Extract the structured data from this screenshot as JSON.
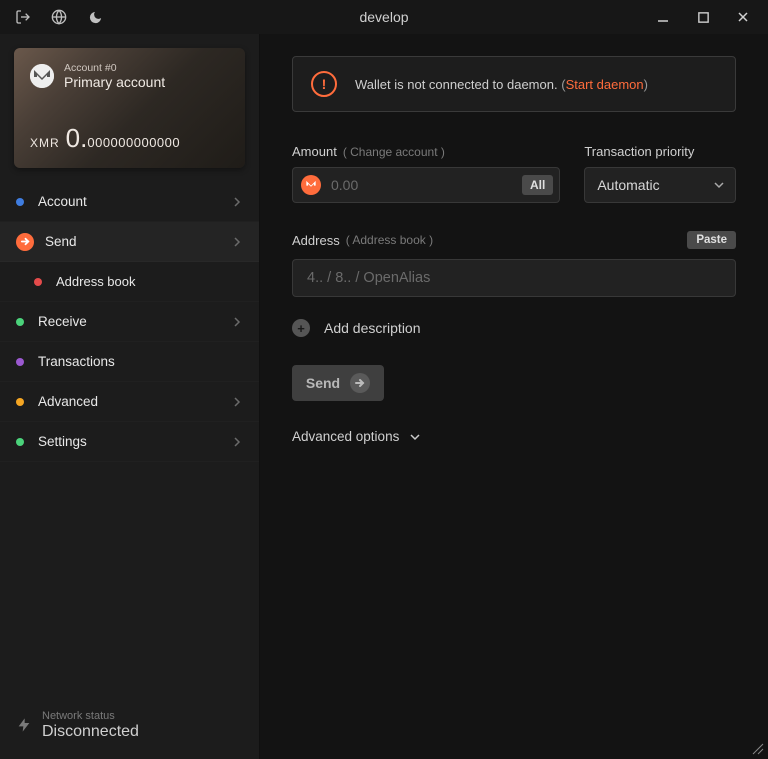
{
  "window": {
    "title": "develop"
  },
  "account_card": {
    "account_num": "Account #0",
    "account_name": "Primary account",
    "currency": "XMR",
    "balance_int": "0.",
    "balance_frac": "000000000000"
  },
  "nav": {
    "account": "Account",
    "send": "Send",
    "address_book": "Address book",
    "receive": "Receive",
    "transactions": "Transactions",
    "advanced": "Advanced",
    "settings": "Settings"
  },
  "network": {
    "label": "Network status",
    "value": "Disconnected"
  },
  "banner": {
    "message": "Wallet is not connected to daemon.",
    "link_text": "Start daemon"
  },
  "form": {
    "amount_label": "Amount",
    "amount_hint": "( Change account )",
    "amount_placeholder": "0.00",
    "all_button": "All",
    "priority_label": "Transaction priority",
    "priority_value": "Automatic",
    "address_label": "Address",
    "address_hint": "( Address book )",
    "address_placeholder": "4.. / 8.. / OpenAlias",
    "paste_button": "Paste",
    "add_description": "Add description",
    "send_button": "Send",
    "advanced_options": "Advanced options"
  }
}
